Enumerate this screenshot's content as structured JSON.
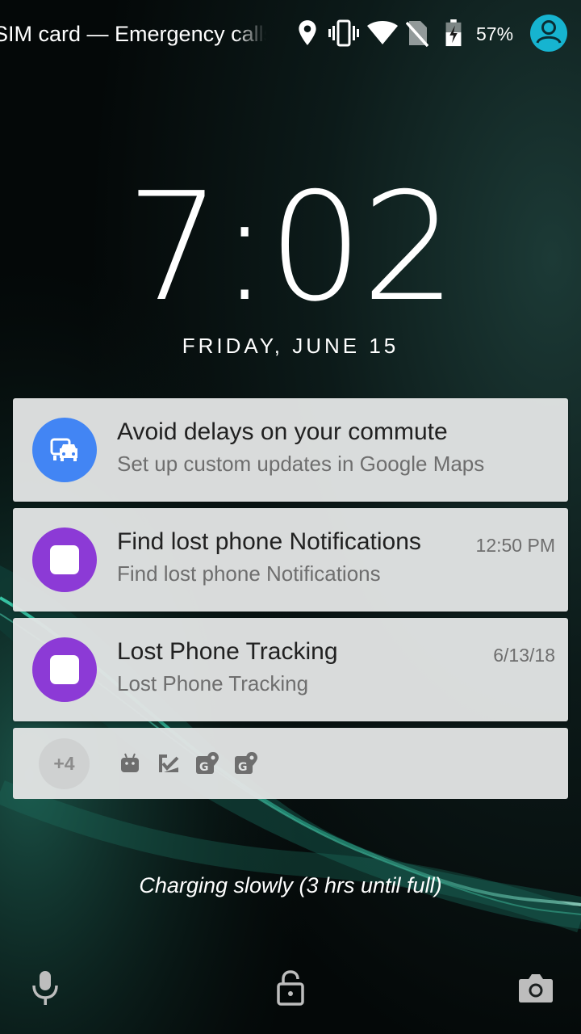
{
  "status_bar": {
    "carrier_text": "SIM card — Emergency calls only",
    "icons": [
      "location-icon",
      "vibrate-icon",
      "wifi-icon",
      "no-sim-icon",
      "battery-charging-icon"
    ],
    "battery_percent": "57%",
    "user_icon": "user-avatar-icon"
  },
  "lockscreen": {
    "time": "7:02",
    "date": "FRIDAY, JUNE 15"
  },
  "notifications": [
    {
      "title": "Avoid delays on your commute",
      "text": "Set up custom updates in Google Maps",
      "time": "",
      "icon": "commute-car-icon",
      "icon_color": "#4285f4"
    },
    {
      "title": "Find lost phone Notifications",
      "text": "Find lost phone Notifications",
      "time": "12:50 PM",
      "icon": "app-square-icon",
      "icon_color": "#8c3ad6"
    },
    {
      "title": "Lost Phone Tracking",
      "text": "Lost Phone Tracking",
      "time": "6/13/18",
      "icon": "app-square-icon",
      "icon_color": "#8c3ad6"
    }
  ],
  "overflow": {
    "count": "+4",
    "icons": [
      "android-icon",
      "tasks-icon",
      "google-maps-icon",
      "google-maps-icon"
    ]
  },
  "charging_status": "Charging slowly (3 hrs until full)",
  "bottom_bar": {
    "icons": [
      "microphone-icon",
      "lock-icon",
      "camera-icon"
    ]
  }
}
